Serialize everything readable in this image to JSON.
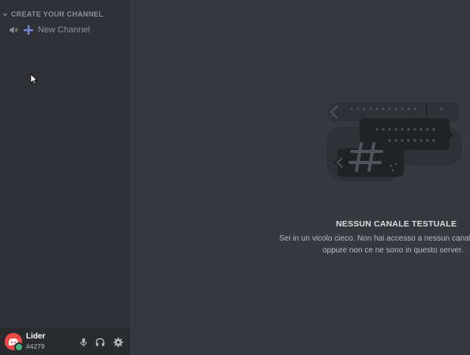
{
  "sidebar": {
    "category": {
      "label": "CREATE YOUR CHANNEL",
      "icon": "chevron-down-icon"
    },
    "channels": [
      {
        "type": "voice",
        "icon": "speaker-icon",
        "action_icon": "plus-icon",
        "label": "New Channel"
      }
    ]
  },
  "user": {
    "name": "Lider",
    "tag": "#4279",
    "status": "online",
    "avatar_color": "#f04747",
    "status_color": "#43b581",
    "controls": [
      {
        "name": "microphone",
        "icon": "microphone-icon"
      },
      {
        "name": "headphones",
        "icon": "headphones-icon"
      },
      {
        "name": "settings",
        "icon": "gear-icon"
      }
    ]
  },
  "empty_state": {
    "title": "NESSUN CANALE TESTUALE",
    "line1": "Sei in un vicolo cieco. Non hai accesso a nessun canale",
    "line2": "oppure non ce ne sono in questo server.",
    "illustration": "no-text-channels-illustration"
  },
  "colors": {
    "sidebar_bg": "#2f3136",
    "main_bg": "#36393f",
    "userbar_bg": "#292b2f",
    "accent_plus": "#7289da"
  }
}
